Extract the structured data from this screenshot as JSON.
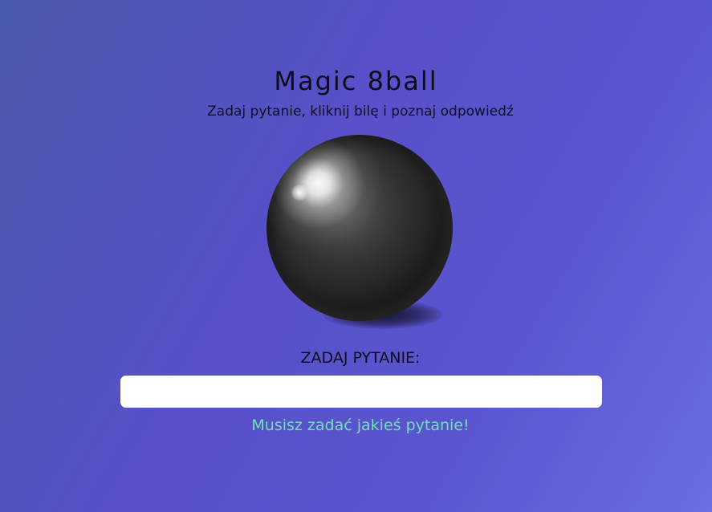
{
  "header": {
    "title": "Magic 8ball",
    "subtitle": "Zadaj pytanie, kliknij bilę i poznaj odpowiedź"
  },
  "form": {
    "question_label": "ZADAJ PYTANIE:",
    "question_value": "",
    "question_placeholder": "",
    "error_message": "Musisz zadać jakieś pytanie!"
  },
  "colors": {
    "background_start": "#4a5aab",
    "background_end": "#6a6ee2",
    "error_text": "#6fe2b5",
    "ball": "#1f1f1f"
  }
}
